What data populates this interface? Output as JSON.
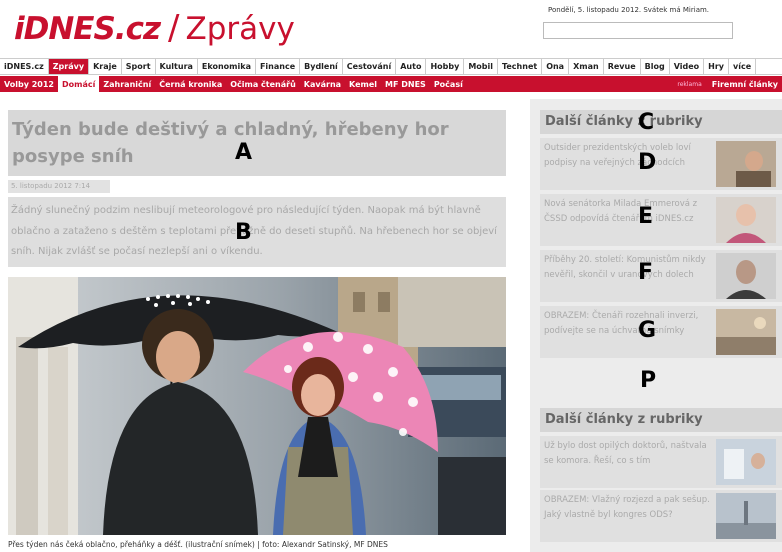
{
  "header": {
    "logo_brand": "iDNES.cz",
    "logo_separator": "/",
    "logo_section": "Zprávy",
    "dateline": "Pondělí, 5. listopadu 2012. Svátek má Miriam.",
    "search_placeholder": ""
  },
  "nav_primary": [
    {
      "label": "iDNES.cz"
    },
    {
      "label": "Zprávy",
      "active": true
    },
    {
      "label": "Kraje"
    },
    {
      "label": "Sport"
    },
    {
      "label": "Kultura"
    },
    {
      "label": "Ekonomika"
    },
    {
      "label": "Finance"
    },
    {
      "label": "Bydlení"
    },
    {
      "label": "Cestování"
    },
    {
      "label": "Auto"
    },
    {
      "label": "Hobby"
    },
    {
      "label": "Mobil"
    },
    {
      "label": "Technet"
    },
    {
      "label": "Ona"
    },
    {
      "label": "Xman"
    },
    {
      "label": "Revue"
    },
    {
      "label": "Blog"
    },
    {
      "label": "Video"
    },
    {
      "label": "Hry"
    },
    {
      "label": "více"
    }
  ],
  "nav_secondary": [
    {
      "label": "Volby 2012"
    },
    {
      "label": "Domácí",
      "active": true
    },
    {
      "label": "Zahraniční"
    },
    {
      "label": "Černá kronika"
    },
    {
      "label": "Očima čtenářů"
    },
    {
      "label": "Kavárna"
    },
    {
      "label": "Kemel"
    },
    {
      "label": "MF DNES"
    },
    {
      "label": "Počasí"
    }
  ],
  "nav_secondary_right": {
    "ad_label": "reklama",
    "business_label": "Firemní články"
  },
  "article": {
    "title": "Týden bude deštivý a chladný, hřebeny hor posype sníh",
    "date": "5. listopadu 2012  7:14",
    "perex": "Žádný slunečný podzim neslibují meteorologové pro následující týden. Naopak má být hlavně oblačno a zataženo s deštěm s teplotami převážně do deseti stupňů. Na hřebenech hor se objeví sníh. Nijak zvlášť se počasí nezlepší ani o víkendu.",
    "caption": "Přes týden nás čeká oblačno, přeháňky a déšť. (ilustrační snímek) | foto: Alexandr Satinský, MF DNES"
  },
  "markers": {
    "a": "A",
    "b": "B",
    "c": "C",
    "d": "D",
    "e": "E",
    "f": "F",
    "g": "G",
    "p": "P"
  },
  "sidebar": {
    "heading_1": "Další články z rubriky",
    "heading_2": "Další články z rubriky",
    "items_1": [
      {
        "text": "Outsider prezidentských voleb loví podpisy na veřejných záchodcích"
      },
      {
        "text": "Nová senátorka Milada Emmerová z ČSSD odpovídá čtenářům iDNES.cz"
      },
      {
        "text": "Příběhy 20. století: Komunistům nikdy nevěřil, skončil v uranových dolech"
      },
      {
        "text": "OBRAZEM: Čtenáři rozehnali inverzi, podívejte se na úchvatné snímky"
      }
    ],
    "items_2": [
      {
        "text": "Už bylo dost opilých doktorů, naštvala se komora. Řeší, co s tím"
      },
      {
        "text": "OBRAZEM: Vlažný rozjezd a pak sešup. Jaký vlastně byl kongres ODS?"
      }
    ]
  },
  "colors": {
    "brand_red": "#c8102e",
    "placeholder_gray": "#d8d8d8"
  }
}
